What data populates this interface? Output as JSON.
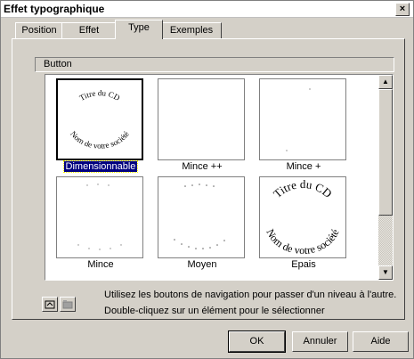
{
  "window": {
    "title": "Effet typographique",
    "close_label": "×"
  },
  "tabs": [
    {
      "label": "Position",
      "accel": "P"
    },
    {
      "label": "Effet",
      "accel": "E"
    },
    {
      "label": "Type",
      "accel": "T"
    },
    {
      "label": "Exemples",
      "accel": ""
    }
  ],
  "path": "Button",
  "items": [
    {
      "label": "Dimensionnable",
      "selected": true,
      "art": "arc-text",
      "top": "Titre du CD",
      "bottom": "Nom de votre société"
    },
    {
      "label": "Mince ++",
      "selected": false,
      "art": "blank"
    },
    {
      "label": "Mince +",
      "selected": false,
      "art": "dots"
    },
    {
      "label": "Mince",
      "selected": false,
      "art": "dots"
    },
    {
      "label": "Moyen",
      "selected": false,
      "art": "dots-arc"
    },
    {
      "label": "Epais",
      "selected": false,
      "art": "arc-text-bold",
      "top": "Titre du CD",
      "bottom": "Nom de votre société"
    }
  ],
  "hints": {
    "line1": "Utilisez les boutons de navigation pour passer d'un niveau à l'autre.",
    "line2": "Double-cliquez sur un élément pour le sélectionner"
  },
  "buttons": {
    "ok": "OK",
    "cancel": "Annuler",
    "help": "Aide"
  }
}
